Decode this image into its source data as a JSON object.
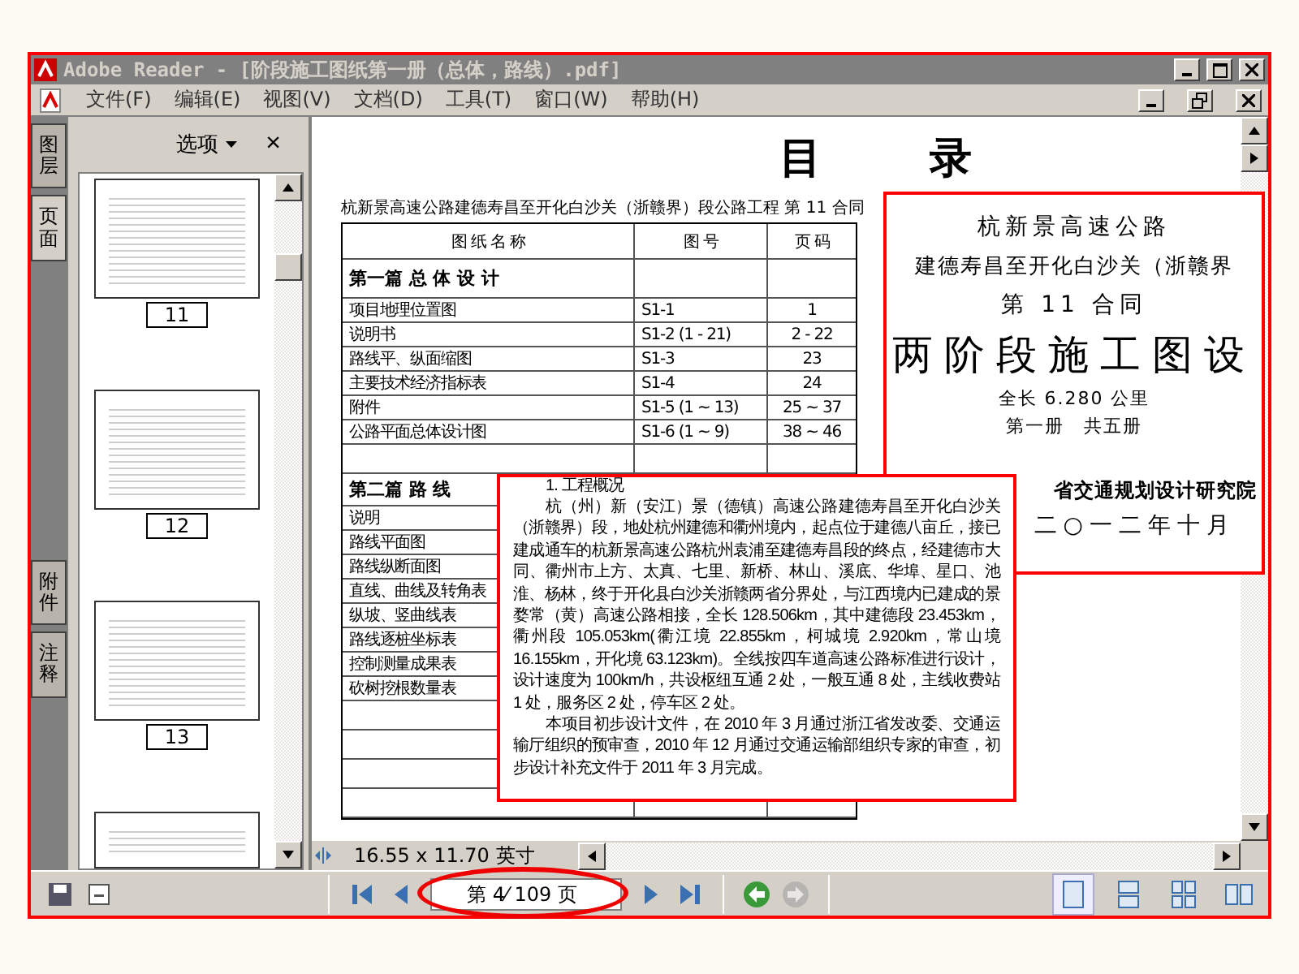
{
  "window": {
    "title": "Adobe Reader - [阶段施工图纸第一册（总体，路线）.pdf]"
  },
  "menu": [
    "文件(F)",
    "编辑(E)",
    "视图(V)",
    "文档(D)",
    "工具(T)",
    "窗口(W)",
    "帮助(H)"
  ],
  "side_tabs": [
    {
      "label": "图层",
      "selected": false
    },
    {
      "label": "页面",
      "selected": true
    },
    {
      "label": "附件",
      "selected": false
    },
    {
      "label": "注释",
      "selected": false
    }
  ],
  "sidebar": {
    "options": "选项",
    "close": "×",
    "thumbnails": [
      {
        "label": "11"
      },
      {
        "label": "12"
      },
      {
        "label": "13"
      }
    ]
  },
  "document": {
    "heading": "目 录",
    "subtitle": "杭新景高速公路建德寿昌至开化白沙关（浙赣界）段公路工程 第 11 合同",
    "columns": [
      "图 纸 名 称",
      "图 号",
      "页 码"
    ],
    "rows": [
      {
        "kind": "section",
        "name": "第一篇 总 体 设 计"
      },
      {
        "kind": "item",
        "name": "项目地理位置图",
        "code": "S1-1",
        "page": "1"
      },
      {
        "kind": "item",
        "name": "说明书",
        "code": "S1-2 (1 - 21)",
        "page": "2 - 22"
      },
      {
        "kind": "item",
        "name": "路线平、纵面缩图",
        "code": "S1-3",
        "page": "23"
      },
      {
        "kind": "item",
        "name": "主要技术经济指标表",
        "code": "S1-4",
        "page": "24"
      },
      {
        "kind": "item",
        "name": "附件",
        "code": "S1-5 (1 ~ 13)",
        "page": "25 ~ 37"
      },
      {
        "kind": "item",
        "name": "公路平面总体设计图",
        "code": "S1-6 (1 ~ 9)",
        "page": "38 ~ 46"
      },
      {
        "kind": "blank"
      },
      {
        "kind": "section",
        "name": "第二篇 路 线"
      },
      {
        "kind": "item",
        "name": "说明"
      },
      {
        "kind": "item",
        "name": "路线平面图"
      },
      {
        "kind": "item",
        "name": "路线纵断面图"
      },
      {
        "kind": "item",
        "name": "直线、曲线及转角表"
      },
      {
        "kind": "item",
        "name": "纵坡、竖曲线表"
      },
      {
        "kind": "item",
        "name": "路线逐桩坐标表"
      },
      {
        "kind": "item",
        "name": "控制测量成果表"
      },
      {
        "kind": "item",
        "name": "砍树挖根数量表"
      },
      {
        "kind": "blank"
      },
      {
        "kind": "blank"
      },
      {
        "kind": "blank"
      },
      {
        "kind": "blank"
      }
    ],
    "cover": {
      "lines": [
        "杭新景高速公路",
        "建德寿昌至开化白沙关（浙赣界",
        "第 11 合同"
      ],
      "title": "两阶段施工图设",
      "length": "全长 6.280 公里",
      "volume": "第一册　共五册",
      "institute": "省交通规划设计研究院",
      "date": "二○一二年十月"
    },
    "excerpt": {
      "heading": "1. 工程概况",
      "paragraphs": [
        "杭（州）新（安江）景（德镇）高速公路建德寿昌至开化白沙关（浙赣界）段，地处杭州建德和衢州境内，起点位于建德八亩丘，接已建成通车的杭新景高速公路杭州袁浦至建德寿昌段的终点，经建德市大同、衢州市上方、太真、七里、新桥、林山、溪底、华埠、星口、池淮、杨林，终于开化县白沙关浙赣两省分界处，与江西境内已建成的景婺常（黄）高速公路相接，全长 128.506km，其中建德段 23.453km，衢州段 105.053km(衢江境 22.855km，柯城境 2.920km，常山境 16.155km，开化境 63.123km)。全线按四车道高速公路标准进行设计，设计速度为 100km/h，共设枢纽互通 2 处，一般互通 8 处，主线收费站 1 处，服务区 2 处，停车区 2 处。",
        "本项目初步设计文件，在 2010 年 3 月通过浙江省发改委、交通运输厅组织的预审查，2010 年 12 月通过交通运输部组织专家的审查，初步设计补充文件于 2011 年 3 月完成。"
      ]
    }
  },
  "status": {
    "page_size": "16.55 x 11.70 英寸",
    "page_field": "第 4⁄ 109 页"
  },
  "nav": [
    {
      "kind": "first",
      "disabled": false
    },
    {
      "kind": "prev",
      "disabled": false
    },
    {
      "kind": "field"
    },
    {
      "kind": "next",
      "disabled": false
    },
    {
      "kind": "last",
      "disabled": false
    },
    {
      "kind": "back",
      "disabled": false
    },
    {
      "kind": "forward",
      "disabled": true
    }
  ],
  "views": [
    {
      "kind": "single",
      "selected": true
    },
    {
      "kind": "continuous",
      "selected": false
    },
    {
      "kind": "continuous-facing",
      "selected": false
    },
    {
      "kind": "facing",
      "selected": false
    }
  ]
}
